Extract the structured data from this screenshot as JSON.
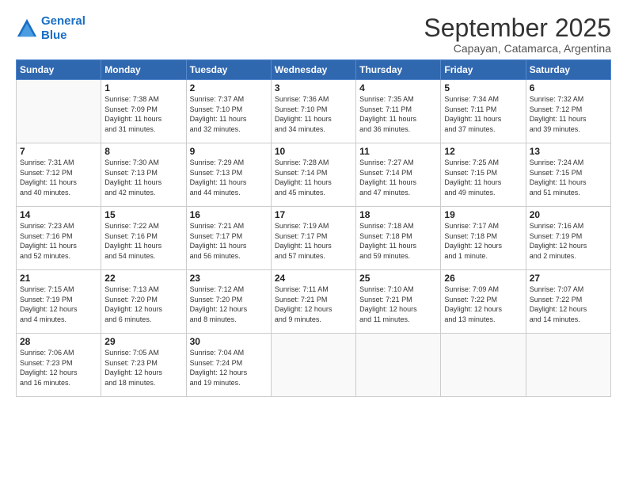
{
  "header": {
    "logo_line1": "General",
    "logo_line2": "Blue",
    "month": "September 2025",
    "location": "Capayan, Catamarca, Argentina"
  },
  "weekdays": [
    "Sunday",
    "Monday",
    "Tuesday",
    "Wednesday",
    "Thursday",
    "Friday",
    "Saturday"
  ],
  "rows": [
    [
      {
        "day": "",
        "lines": []
      },
      {
        "day": "1",
        "lines": [
          "Sunrise: 7:38 AM",
          "Sunset: 7:09 PM",
          "Daylight: 11 hours",
          "and 31 minutes."
        ]
      },
      {
        "day": "2",
        "lines": [
          "Sunrise: 7:37 AM",
          "Sunset: 7:10 PM",
          "Daylight: 11 hours",
          "and 32 minutes."
        ]
      },
      {
        "day": "3",
        "lines": [
          "Sunrise: 7:36 AM",
          "Sunset: 7:10 PM",
          "Daylight: 11 hours",
          "and 34 minutes."
        ]
      },
      {
        "day": "4",
        "lines": [
          "Sunrise: 7:35 AM",
          "Sunset: 7:11 PM",
          "Daylight: 11 hours",
          "and 36 minutes."
        ]
      },
      {
        "day": "5",
        "lines": [
          "Sunrise: 7:34 AM",
          "Sunset: 7:11 PM",
          "Daylight: 11 hours",
          "and 37 minutes."
        ]
      },
      {
        "day": "6",
        "lines": [
          "Sunrise: 7:32 AM",
          "Sunset: 7:12 PM",
          "Daylight: 11 hours",
          "and 39 minutes."
        ]
      }
    ],
    [
      {
        "day": "7",
        "lines": [
          "Sunrise: 7:31 AM",
          "Sunset: 7:12 PM",
          "Daylight: 11 hours",
          "and 40 minutes."
        ]
      },
      {
        "day": "8",
        "lines": [
          "Sunrise: 7:30 AM",
          "Sunset: 7:13 PM",
          "Daylight: 11 hours",
          "and 42 minutes."
        ]
      },
      {
        "day": "9",
        "lines": [
          "Sunrise: 7:29 AM",
          "Sunset: 7:13 PM",
          "Daylight: 11 hours",
          "and 44 minutes."
        ]
      },
      {
        "day": "10",
        "lines": [
          "Sunrise: 7:28 AM",
          "Sunset: 7:14 PM",
          "Daylight: 11 hours",
          "and 45 minutes."
        ]
      },
      {
        "day": "11",
        "lines": [
          "Sunrise: 7:27 AM",
          "Sunset: 7:14 PM",
          "Daylight: 11 hours",
          "and 47 minutes."
        ]
      },
      {
        "day": "12",
        "lines": [
          "Sunrise: 7:25 AM",
          "Sunset: 7:15 PM",
          "Daylight: 11 hours",
          "and 49 minutes."
        ]
      },
      {
        "day": "13",
        "lines": [
          "Sunrise: 7:24 AM",
          "Sunset: 7:15 PM",
          "Daylight: 11 hours",
          "and 51 minutes."
        ]
      }
    ],
    [
      {
        "day": "14",
        "lines": [
          "Sunrise: 7:23 AM",
          "Sunset: 7:16 PM",
          "Daylight: 11 hours",
          "and 52 minutes."
        ]
      },
      {
        "day": "15",
        "lines": [
          "Sunrise: 7:22 AM",
          "Sunset: 7:16 PM",
          "Daylight: 11 hours",
          "and 54 minutes."
        ]
      },
      {
        "day": "16",
        "lines": [
          "Sunrise: 7:21 AM",
          "Sunset: 7:17 PM",
          "Daylight: 11 hours",
          "and 56 minutes."
        ]
      },
      {
        "day": "17",
        "lines": [
          "Sunrise: 7:19 AM",
          "Sunset: 7:17 PM",
          "Daylight: 11 hours",
          "and 57 minutes."
        ]
      },
      {
        "day": "18",
        "lines": [
          "Sunrise: 7:18 AM",
          "Sunset: 7:18 PM",
          "Daylight: 11 hours",
          "and 59 minutes."
        ]
      },
      {
        "day": "19",
        "lines": [
          "Sunrise: 7:17 AM",
          "Sunset: 7:18 PM",
          "Daylight: 12 hours",
          "and 1 minute."
        ]
      },
      {
        "day": "20",
        "lines": [
          "Sunrise: 7:16 AM",
          "Sunset: 7:19 PM",
          "Daylight: 12 hours",
          "and 2 minutes."
        ]
      }
    ],
    [
      {
        "day": "21",
        "lines": [
          "Sunrise: 7:15 AM",
          "Sunset: 7:19 PM",
          "Daylight: 12 hours",
          "and 4 minutes."
        ]
      },
      {
        "day": "22",
        "lines": [
          "Sunrise: 7:13 AM",
          "Sunset: 7:20 PM",
          "Daylight: 12 hours",
          "and 6 minutes."
        ]
      },
      {
        "day": "23",
        "lines": [
          "Sunrise: 7:12 AM",
          "Sunset: 7:20 PM",
          "Daylight: 12 hours",
          "and 8 minutes."
        ]
      },
      {
        "day": "24",
        "lines": [
          "Sunrise: 7:11 AM",
          "Sunset: 7:21 PM",
          "Daylight: 12 hours",
          "and 9 minutes."
        ]
      },
      {
        "day": "25",
        "lines": [
          "Sunrise: 7:10 AM",
          "Sunset: 7:21 PM",
          "Daylight: 12 hours",
          "and 11 minutes."
        ]
      },
      {
        "day": "26",
        "lines": [
          "Sunrise: 7:09 AM",
          "Sunset: 7:22 PM",
          "Daylight: 12 hours",
          "and 13 minutes."
        ]
      },
      {
        "day": "27",
        "lines": [
          "Sunrise: 7:07 AM",
          "Sunset: 7:22 PM",
          "Daylight: 12 hours",
          "and 14 minutes."
        ]
      }
    ],
    [
      {
        "day": "28",
        "lines": [
          "Sunrise: 7:06 AM",
          "Sunset: 7:23 PM",
          "Daylight: 12 hours",
          "and 16 minutes."
        ]
      },
      {
        "day": "29",
        "lines": [
          "Sunrise: 7:05 AM",
          "Sunset: 7:23 PM",
          "Daylight: 12 hours",
          "and 18 minutes."
        ]
      },
      {
        "day": "30",
        "lines": [
          "Sunrise: 7:04 AM",
          "Sunset: 7:24 PM",
          "Daylight: 12 hours",
          "and 19 minutes."
        ]
      },
      {
        "day": "",
        "lines": []
      },
      {
        "day": "",
        "lines": []
      },
      {
        "day": "",
        "lines": []
      },
      {
        "day": "",
        "lines": []
      }
    ]
  ]
}
